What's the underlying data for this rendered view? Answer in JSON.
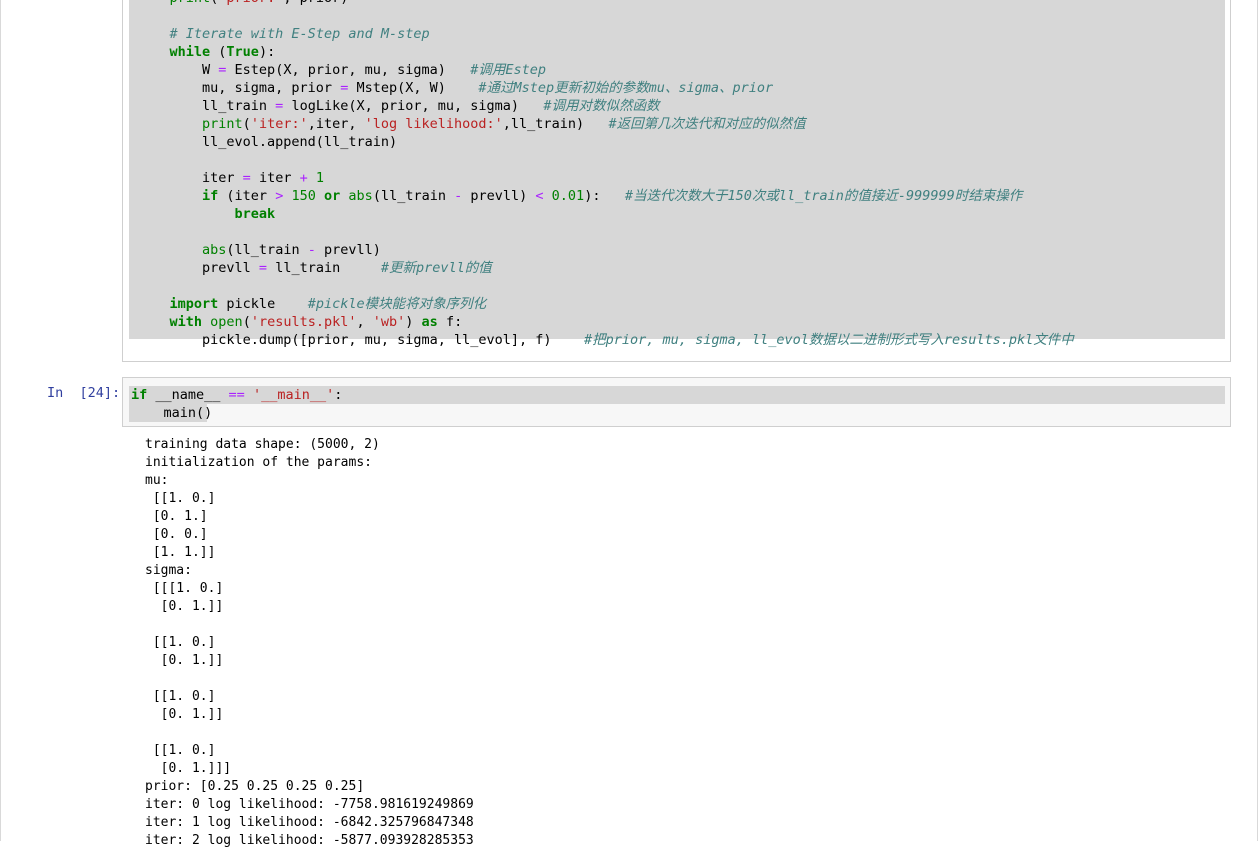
{
  "cell_prev": {
    "lines": [
      [
        [
          "    ",
          ""
        ],
        [
          "print",
          "bi"
        ],
        [
          "(",
          ""
        ],
        [
          "'prior:'",
          "str"
        ],
        [
          ", prior)",
          ""
        ]
      ],
      [
        [
          "",
          ""
        ]
      ],
      [
        [
          "    ",
          ""
        ],
        [
          "# Iterate with E-Step and M-step",
          "cm"
        ]
      ],
      [
        [
          "    ",
          ""
        ],
        [
          "while",
          "kw"
        ],
        [
          " (",
          ""
        ],
        [
          "True",
          "kw"
        ],
        [
          "):",
          ""
        ]
      ],
      [
        [
          "        W ",
          ""
        ],
        [
          "=",
          "op"
        ],
        [
          " Estep(X, prior, mu, sigma)   ",
          ""
        ],
        [
          "#调用Estep",
          "cm"
        ]
      ],
      [
        [
          "        mu, sigma, prior ",
          ""
        ],
        [
          "=",
          "op"
        ],
        [
          " Mstep(X, W)    ",
          ""
        ],
        [
          "#通过Mstep更新初始的参数mu、sigma、prior",
          "cm"
        ]
      ],
      [
        [
          "        ll_train ",
          ""
        ],
        [
          "=",
          "op"
        ],
        [
          " logLike(X, prior, mu, sigma)   ",
          ""
        ],
        [
          "#调用对数似然函数",
          "cm"
        ]
      ],
      [
        [
          "        ",
          ""
        ],
        [
          "print",
          "bi"
        ],
        [
          "(",
          ""
        ],
        [
          "'iter:'",
          "str"
        ],
        [
          ",iter, ",
          ""
        ],
        [
          "'log likelihood:'",
          "str"
        ],
        [
          ",ll_train)   ",
          ""
        ],
        [
          "#返回第几次迭代和对应的似然值",
          "cm"
        ]
      ],
      [
        [
          "        ll_evol.append(ll_train)",
          ""
        ]
      ],
      [
        [
          "",
          ""
        ]
      ],
      [
        [
          "        iter ",
          ""
        ],
        [
          "=",
          "op"
        ],
        [
          " iter ",
          ""
        ],
        [
          "+",
          "op"
        ],
        [
          " ",
          ""
        ],
        [
          "1",
          "num"
        ]
      ],
      [
        [
          "        ",
          ""
        ],
        [
          "if",
          "kw"
        ],
        [
          " (iter ",
          ""
        ],
        [
          ">",
          "op"
        ],
        [
          " ",
          ""
        ],
        [
          "150",
          "num"
        ],
        [
          " ",
          ""
        ],
        [
          "or",
          "kw"
        ],
        [
          " ",
          ""
        ],
        [
          "abs",
          "bi"
        ],
        [
          "(ll_train ",
          ""
        ],
        [
          "-",
          "op"
        ],
        [
          " prevll) ",
          ""
        ],
        [
          "<",
          "op"
        ],
        [
          " ",
          ""
        ],
        [
          "0.01",
          "num"
        ],
        [
          "):   ",
          ""
        ],
        [
          "#当迭代次数大于150次或ll_train的值接近-999999时结束操作",
          "cm"
        ]
      ],
      [
        [
          "            ",
          ""
        ],
        [
          "break",
          "kw"
        ]
      ],
      [
        [
          "",
          ""
        ]
      ],
      [
        [
          "        ",
          ""
        ],
        [
          "abs",
          "bi"
        ],
        [
          "(ll_train ",
          ""
        ],
        [
          "-",
          "op"
        ],
        [
          " prevll)",
          ""
        ]
      ],
      [
        [
          "        prevll ",
          ""
        ],
        [
          "=",
          "op"
        ],
        [
          " ll_train     ",
          ""
        ],
        [
          "#更新prevll的值",
          "cm"
        ]
      ],
      [
        [
          "",
          ""
        ]
      ],
      [
        [
          "    ",
          ""
        ],
        [
          "import",
          "kw"
        ],
        [
          " pickle    ",
          ""
        ],
        [
          "#pickle模块能将对象序列化",
          "cm"
        ]
      ],
      [
        [
          "    ",
          ""
        ],
        [
          "with",
          "kw"
        ],
        [
          " ",
          ""
        ],
        [
          "open",
          "bi"
        ],
        [
          "(",
          ""
        ],
        [
          "'results.pkl'",
          "str"
        ],
        [
          ", ",
          ""
        ],
        [
          "'wb'",
          "str"
        ],
        [
          ") ",
          ""
        ],
        [
          "as",
          "kw"
        ],
        [
          " f:",
          ""
        ]
      ],
      [
        [
          "        pickle.dump([prior, mu, sigma, ll_evol], f)    ",
          ""
        ],
        [
          "#把prior, mu, sigma, ll_evol数据以二进制形式写入results.pkl文件中",
          "cm"
        ]
      ]
    ]
  },
  "cell_main": {
    "prompt": "In  [24]:",
    "lines": [
      [
        [
          "if",
          "kw"
        ],
        [
          " __name__ ",
          ""
        ],
        [
          "==",
          "op"
        ],
        [
          " ",
          ""
        ],
        [
          "'__main__'",
          "str"
        ],
        [
          ":",
          ""
        ]
      ],
      [
        [
          "    main()",
          ""
        ]
      ]
    ]
  },
  "output": {
    "lines": [
      "training data shape: (5000, 2)",
      "initialization of the params:",
      "mu:",
      " [[1. 0.]",
      " [0. 1.]",
      " [0. 0.]",
      " [1. 1.]]",
      "sigma:",
      " [[[1. 0.]",
      "  [0. 1.]]",
      "",
      " [[1. 0.]",
      "  [0. 1.]]",
      "",
      " [[1. 0.]",
      "  [0. 1.]]",
      "",
      " [[1. 0.]",
      "  [0. 1.]]]",
      "prior: [0.25 0.25 0.25 0.25]",
      "iter: 0 log likelihood: -7758.981619249869",
      "iter: 1 log likelihood: -6842.325796847348",
      "iter: 2 log likelihood: -5877.093928285353"
    ]
  }
}
